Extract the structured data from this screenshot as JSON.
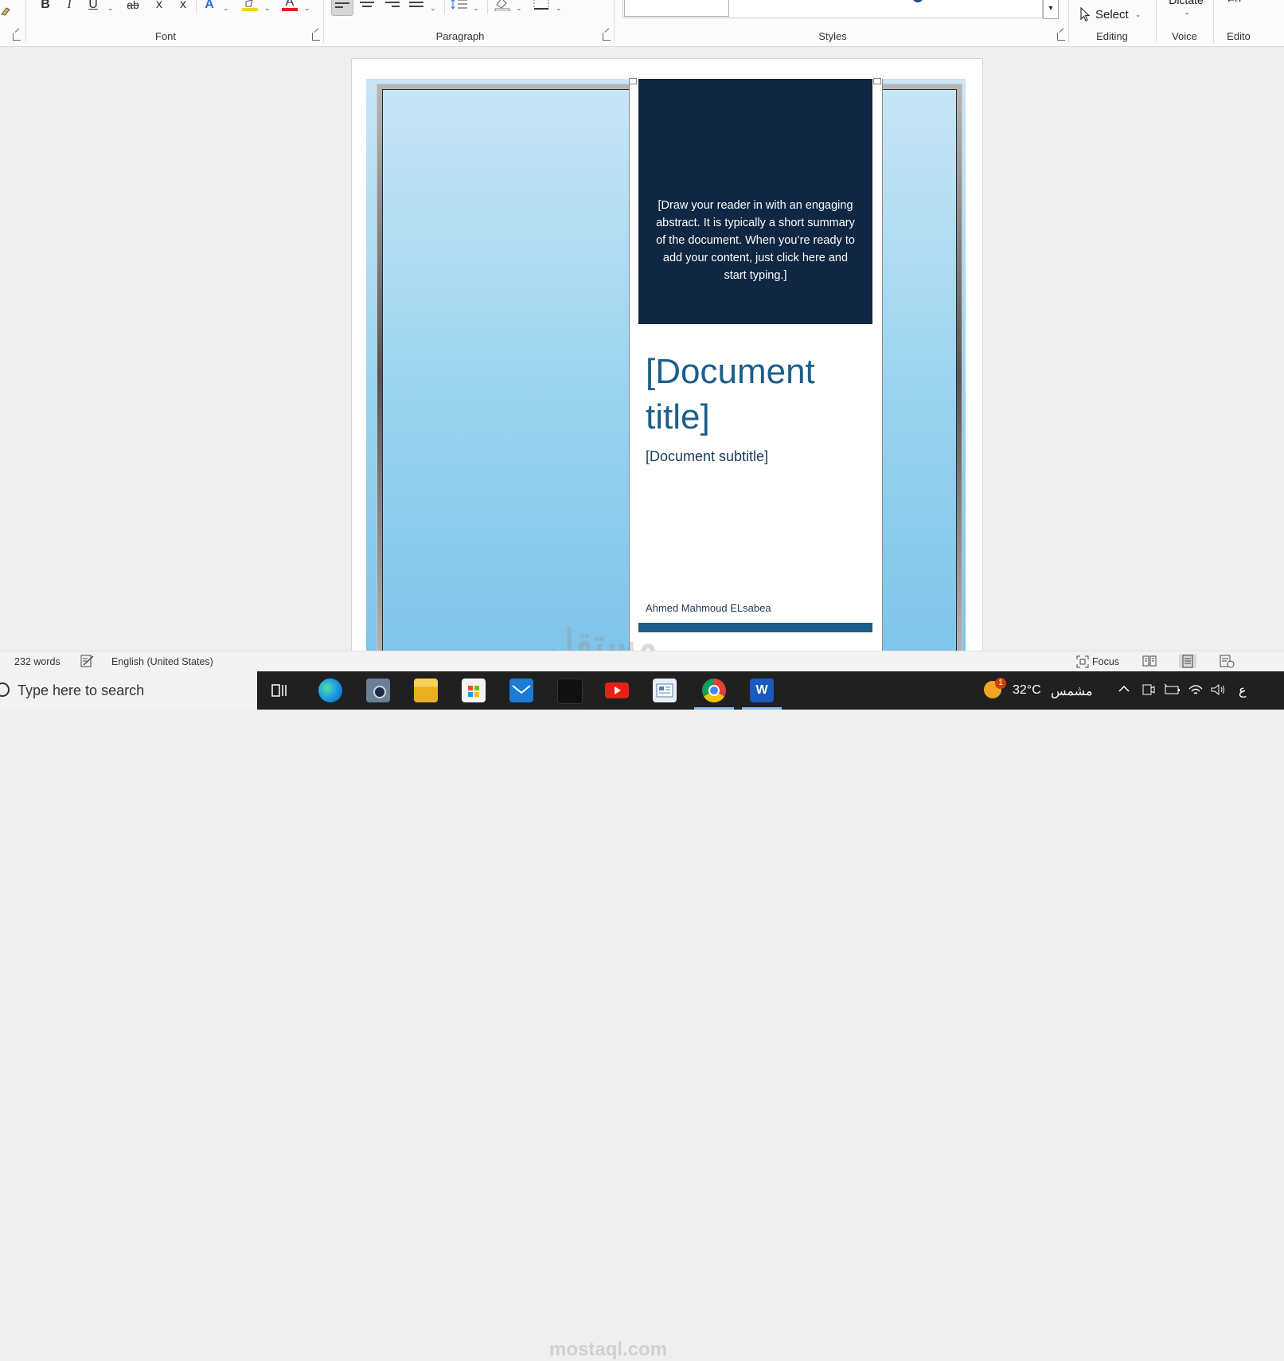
{
  "ribbon": {
    "groups": {
      "font": "Font",
      "paragraph": "Paragraph",
      "styles": "Styles",
      "editing": "Editing",
      "voice": "Voice",
      "editor_partial": "Edito"
    },
    "font_buttons": {
      "bold": "B",
      "italic": "I",
      "underline": "U",
      "strikethrough": "ab",
      "subscript": "x",
      "superscript": "x",
      "text_effects": "A",
      "font_color": "A"
    },
    "select_label": "Select",
    "dictate_label": "Dictate"
  },
  "document": {
    "abstract": "[Draw your reader in with an engaging abstract. It is typically a short summary of the document. When you’re ready to add your content, just click here and start typing.]",
    "title": "[Document title]",
    "subtitle": "[Document subtitle]",
    "author": "Ahmed Mahmoud ELsabea"
  },
  "colors": {
    "abstract_bg": "#0f2742",
    "title": "#1c5f8b",
    "accent_bar": "#1a5d85",
    "gradient_top": "#c8e6f5",
    "gradient_bottom": "#7fc5ea"
  },
  "statusbar": {
    "word_count": "232 words",
    "language": "English (United States)",
    "focus": "Focus"
  },
  "taskbar": {
    "search_placeholder": "Type here to search",
    "temperature": "32°C",
    "weather": "مشمس",
    "notification_badge": "1",
    "apps": [
      "task-view",
      "edge",
      "camera",
      "file-explorer",
      "microsoft-store",
      "mail",
      "media",
      "youtube",
      "news",
      "chrome",
      "word"
    ]
  },
  "watermark": {
    "text": "مستقل",
    "url": "mostaql.com"
  }
}
